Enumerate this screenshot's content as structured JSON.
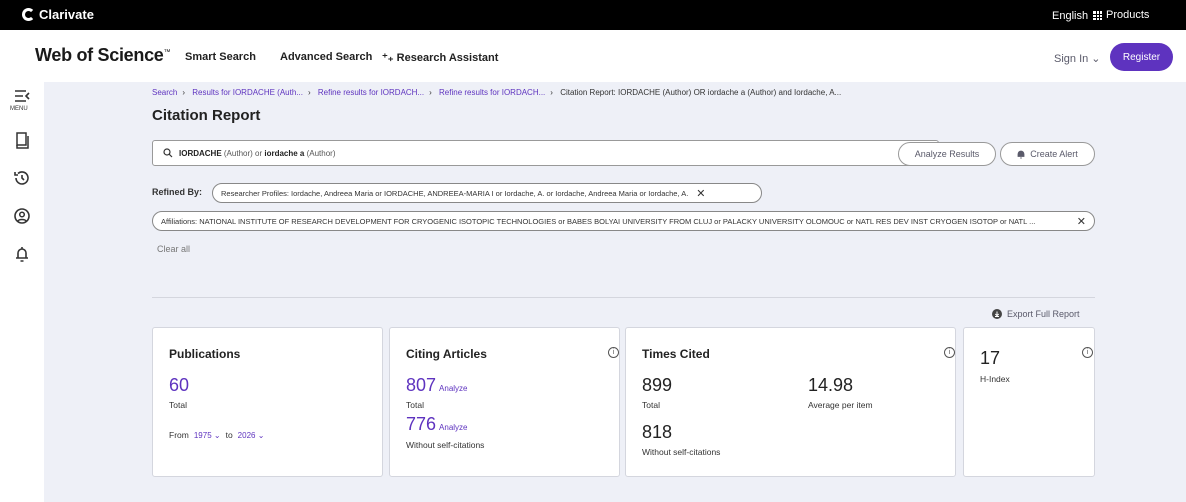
{
  "topbar": {
    "brand": "Clarivate",
    "language": "English ⌄",
    "products": "Products"
  },
  "header": {
    "logo": "Web of Science",
    "logo_tm": "™",
    "nav": [
      "Smart Search",
      "Advanced Search",
      "⁺₊ Research Assistant"
    ],
    "signin": "Sign In ⌄",
    "register": "Register"
  },
  "sidebar": {
    "menu_label": "MENU"
  },
  "breadcrumb": {
    "items": [
      "Search",
      "Results for IORDACHE (Auth...",
      "Refine results for IORDACH...",
      "Refine results for IORDACH..."
    ],
    "current": "Citation Report: IORDACHE (Author) OR iordache a (Author) and Iordache, A..."
  },
  "page": {
    "title": "Citation Report"
  },
  "search": {
    "term1": "IORDACHE",
    "field1": " (Author) or ",
    "term2": "iordache a",
    "field2": " (Author)",
    "analyze": "Analyze Results",
    "create_alert": "Create Alert"
  },
  "refined": {
    "label": "Refined By:",
    "chip1": "Researcher Profiles: Iordache, Andreea Maria or IORDACHE, ANDREEA-MARIA I or Iordache, A. or Iordache, Andreea Maria or Iordache, A.",
    "chip2": "Affiliations: NATIONAL INSTITUTE OF RESEARCH DEVELOPMENT FOR CRYOGENIC ISOTOPIC TECHNOLOGIES or BABES BOLYAI UNIVERSITY FROM CLUJ or PALACKY UNIVERSITY OLOMOUC or NATL RES DEV INST CRYOGEN ISOTOP or NATL ...",
    "clear_all": "Clear all"
  },
  "export": "Export Full Report",
  "publications": {
    "title": "Publications",
    "count": "60",
    "label": "Total",
    "from": "From",
    "from_year": "1975 ⌄",
    "to": "to",
    "to_year": "2026 ⌄"
  },
  "citing": {
    "title": "Citing Articles",
    "total": "807",
    "total_label": "Total",
    "without": "776",
    "without_label": "Without self-citations",
    "analyze": "Analyze"
  },
  "cited": {
    "title": "Times Cited",
    "total": "899",
    "total_label": "Total",
    "avg": "14.98",
    "avg_label": "Average per item",
    "without": "818",
    "without_label": "Without self-citations"
  },
  "hindex": {
    "value": "17",
    "label": "H-Index"
  },
  "colors": {
    "accent": "#5e33bf",
    "background": "#eef0f7",
    "topbar": "#000000"
  }
}
